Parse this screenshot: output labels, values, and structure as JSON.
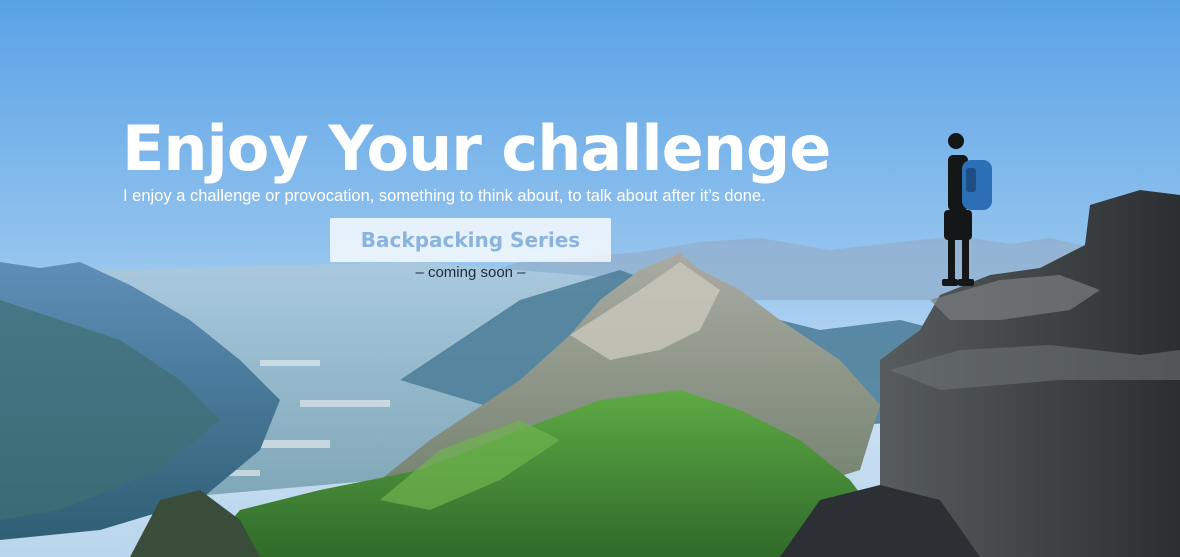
{
  "hero": {
    "headline": "Enjoy Your challenge",
    "tagline": "I enjoy a challenge or provocation, something to think about, to talk about after it’s done.",
    "button_label": "Backpacking Series",
    "status_note": "– coming soon –"
  },
  "colors": {
    "sky_top": "#5aa2e6",
    "sky_bottom": "#c9dff2",
    "grass": "#4f9a3a",
    "rock": "#3f4347",
    "button_text": "#8bb3de"
  }
}
